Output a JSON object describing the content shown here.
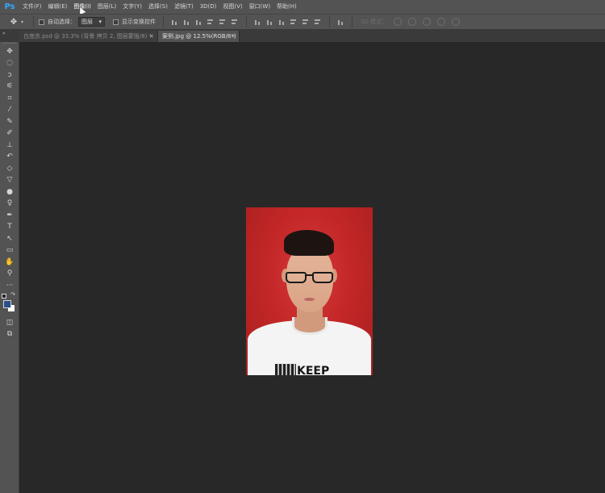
{
  "app": {
    "logo": "Ps"
  },
  "menu": [
    {
      "label": "文件(F)",
      "active": false
    },
    {
      "label": "编辑(E)",
      "active": false
    },
    {
      "label": "图像(I)",
      "active": true
    },
    {
      "label": "图层(L)",
      "active": false
    },
    {
      "label": "文字(Y)",
      "active": false
    },
    {
      "label": "选择(S)",
      "active": false
    },
    {
      "label": "滤镜(T)",
      "active": false
    },
    {
      "label": "3D(D)",
      "active": false
    },
    {
      "label": "视图(V)",
      "active": false
    },
    {
      "label": "窗口(W)",
      "active": false
    },
    {
      "label": "帮助(H)",
      "active": false
    }
  ],
  "options": {
    "tool_icon": "move-icon",
    "auto_select_label": "自动选择：",
    "auto_select_value": "图层",
    "show_transform_label": "显示变换控件",
    "mode_3d_label": "3D 模式："
  },
  "tabs": [
    {
      "title": "白底衣.psd @ 33.3% (背景 拷贝 2, 图层蒙版/8) *",
      "active": false,
      "close": "×"
    },
    {
      "title": "案例.jpg @ 12.5%(RGB/8*)",
      "active": true,
      "close": "×"
    }
  ],
  "toolbox": {
    "tools": [
      {
        "name": "move-tool",
        "icon": "✥"
      },
      {
        "name": "marquee-tool",
        "icon": "◌"
      },
      {
        "name": "lasso-tool",
        "icon": "ↄ"
      },
      {
        "name": "quick-select-tool",
        "icon": "⚟"
      },
      {
        "name": "crop-tool",
        "icon": "⌗"
      },
      {
        "name": "eyedropper-tool",
        "icon": "⁄"
      },
      {
        "name": "healing-brush-tool",
        "icon": "✎"
      },
      {
        "name": "brush-tool",
        "icon": "✐"
      },
      {
        "name": "clone-stamp-tool",
        "icon": "⊥"
      },
      {
        "name": "history-brush-tool",
        "icon": "↶"
      },
      {
        "name": "eraser-tool",
        "icon": "◇"
      },
      {
        "name": "paint-bucket-tool",
        "icon": "▽"
      },
      {
        "name": "blur-tool",
        "icon": "●"
      },
      {
        "name": "dodge-tool",
        "icon": "♀"
      },
      {
        "name": "pen-tool",
        "icon": "✒"
      },
      {
        "name": "type-tool",
        "icon": "T"
      },
      {
        "name": "path-select-tool",
        "icon": "↖"
      },
      {
        "name": "rectangle-tool",
        "icon": "▭"
      },
      {
        "name": "hand-tool",
        "icon": "✋"
      },
      {
        "name": "zoom-tool",
        "icon": "⚲"
      },
      {
        "name": "more-tools",
        "icon": "···"
      },
      {
        "name": "quick-mask",
        "icon": "◫"
      },
      {
        "name": "screen-mode",
        "icon": "⧉"
      }
    ],
    "foreground_color": "#2a4f8a",
    "background_color": "#ffffff"
  },
  "canvas": {
    "photo_shirt_text": "KEEP",
    "background_color": "#c42727"
  }
}
